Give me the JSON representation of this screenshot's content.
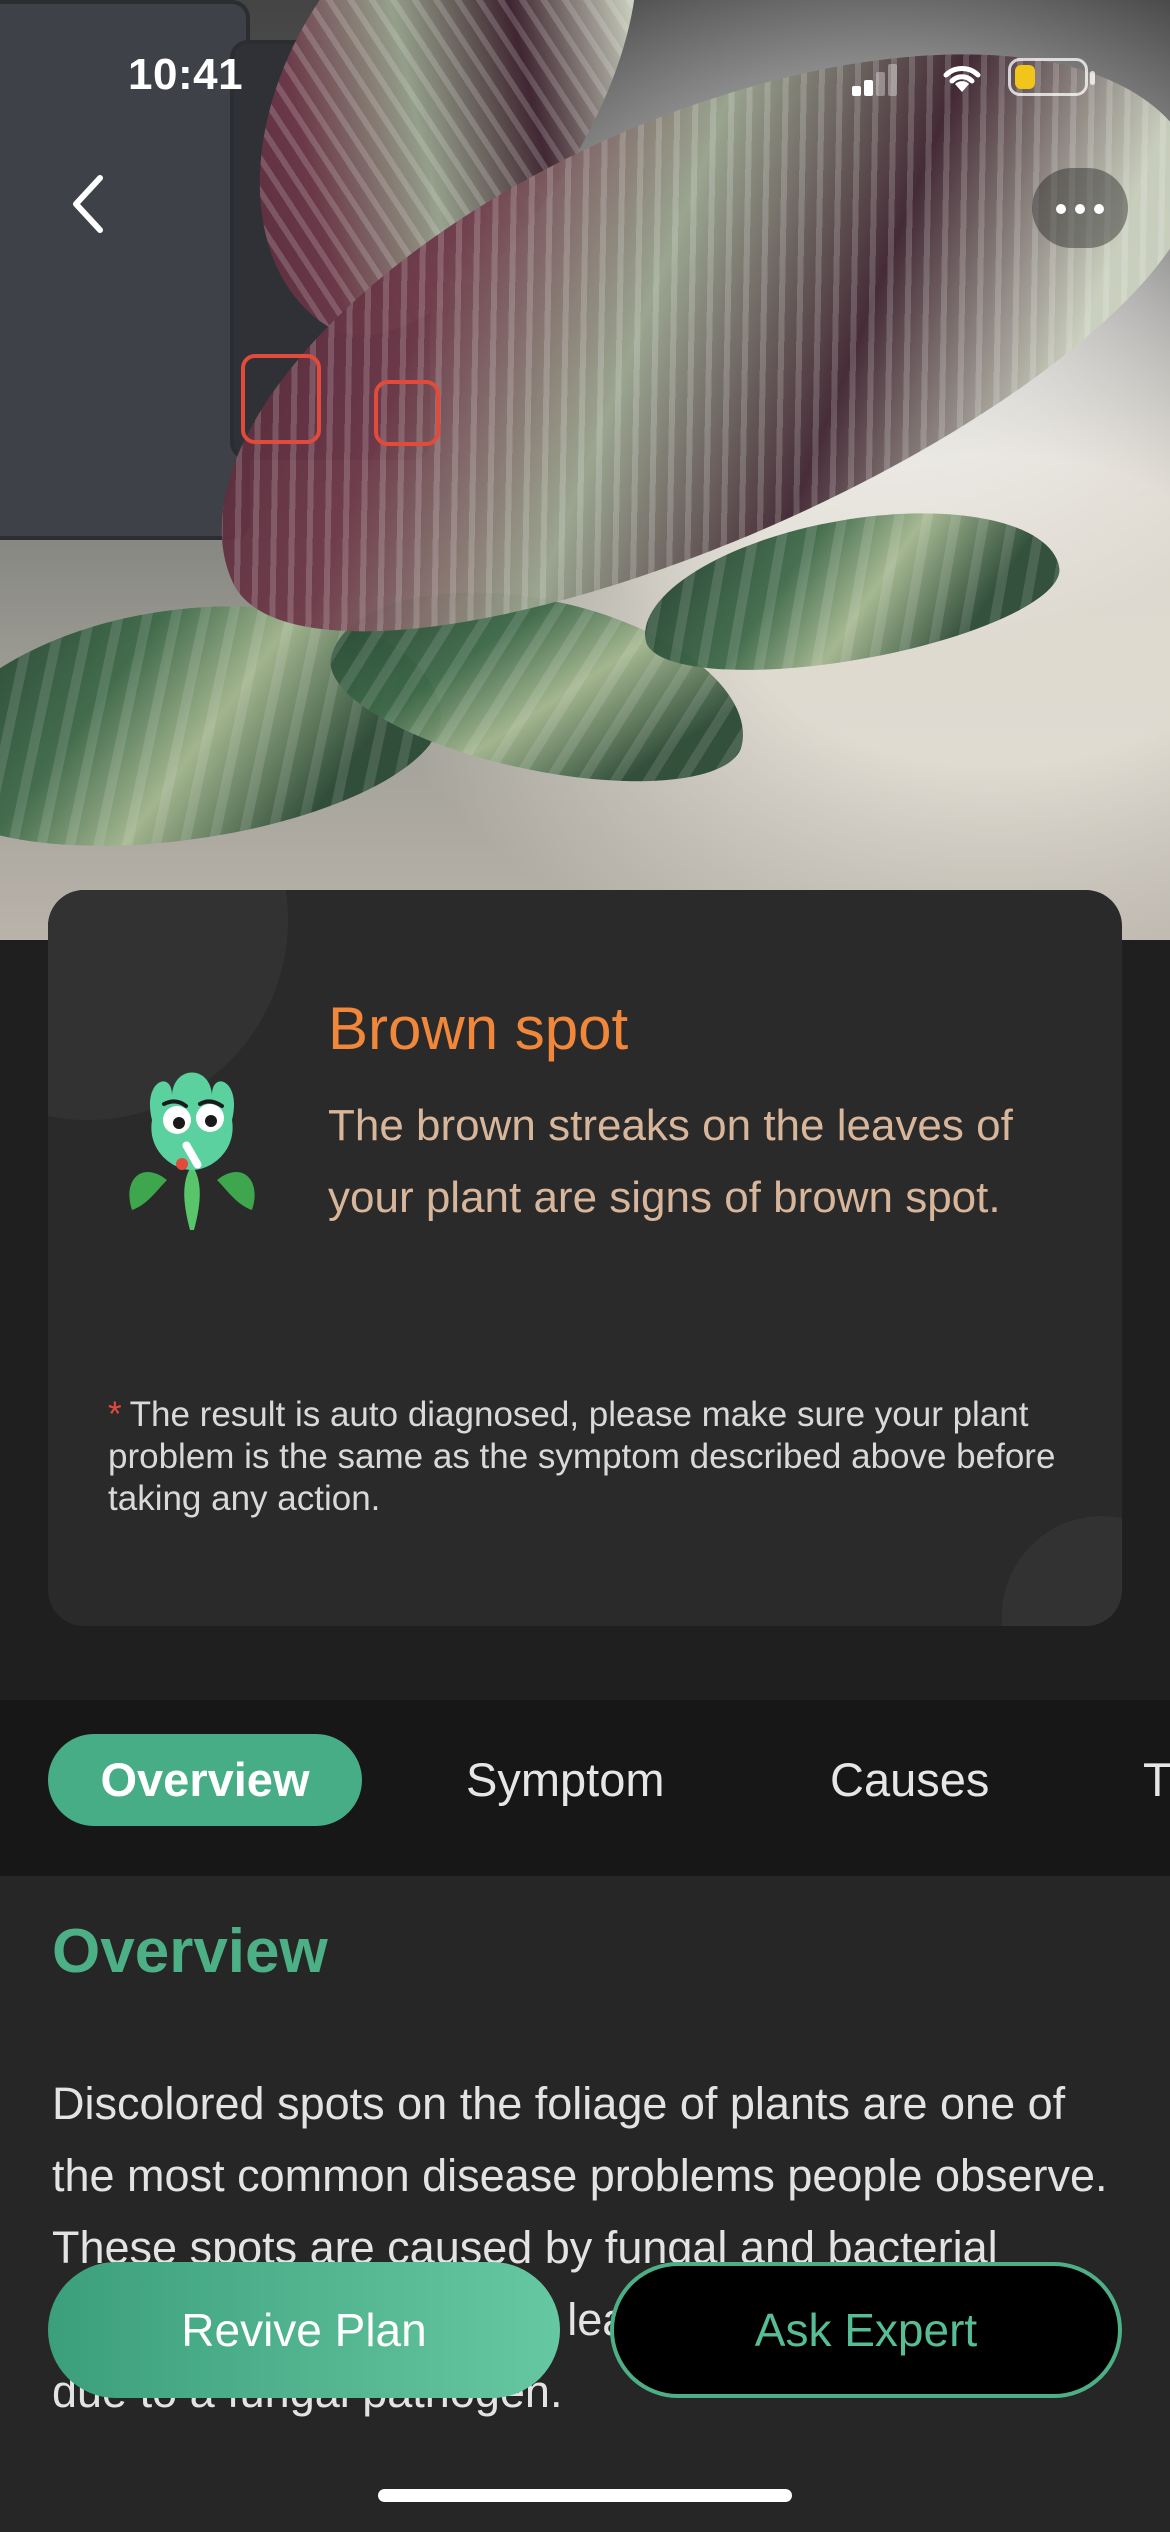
{
  "status_bar": {
    "time": "10:41"
  },
  "nav": {
    "back_icon": "chevron-left-icon",
    "more_icon": "ellipsis-icon"
  },
  "photo": {
    "detected_regions": 2,
    "marker_color": "#e14b3c"
  },
  "diagnosis": {
    "title": "Brown spot",
    "description": "The brown streaks on the leaves of your plant are signs of brown spot.",
    "note_marker": "*",
    "note": "The result is auto diagnosed, please make sure your plant problem is the same as the symptom described above before taking any action.",
    "mascot_icon": "sick-plant-mascot-icon"
  },
  "tabs": [
    {
      "label": "Overview",
      "active": true
    },
    {
      "label": "Symptom",
      "active": false
    },
    {
      "label": "Causes",
      "active": false
    },
    {
      "label": "T",
      "active": false
    }
  ],
  "section": {
    "title": "Overview",
    "body": "Discolored spots on the foliage of plants are one of the most common disease problems people observe. These spots are caused by fungal and bacterial infections. Brown spot on leaves is more likely to be due to a fungal pathogen."
  },
  "actions": {
    "revive": "Revive Plan",
    "expert": "Ask Expert"
  },
  "colors": {
    "accent": "#46ad86",
    "title_orange": "#f0873a",
    "desc_tan": "#d8b69b",
    "card_bg": "#2a2a2a"
  }
}
